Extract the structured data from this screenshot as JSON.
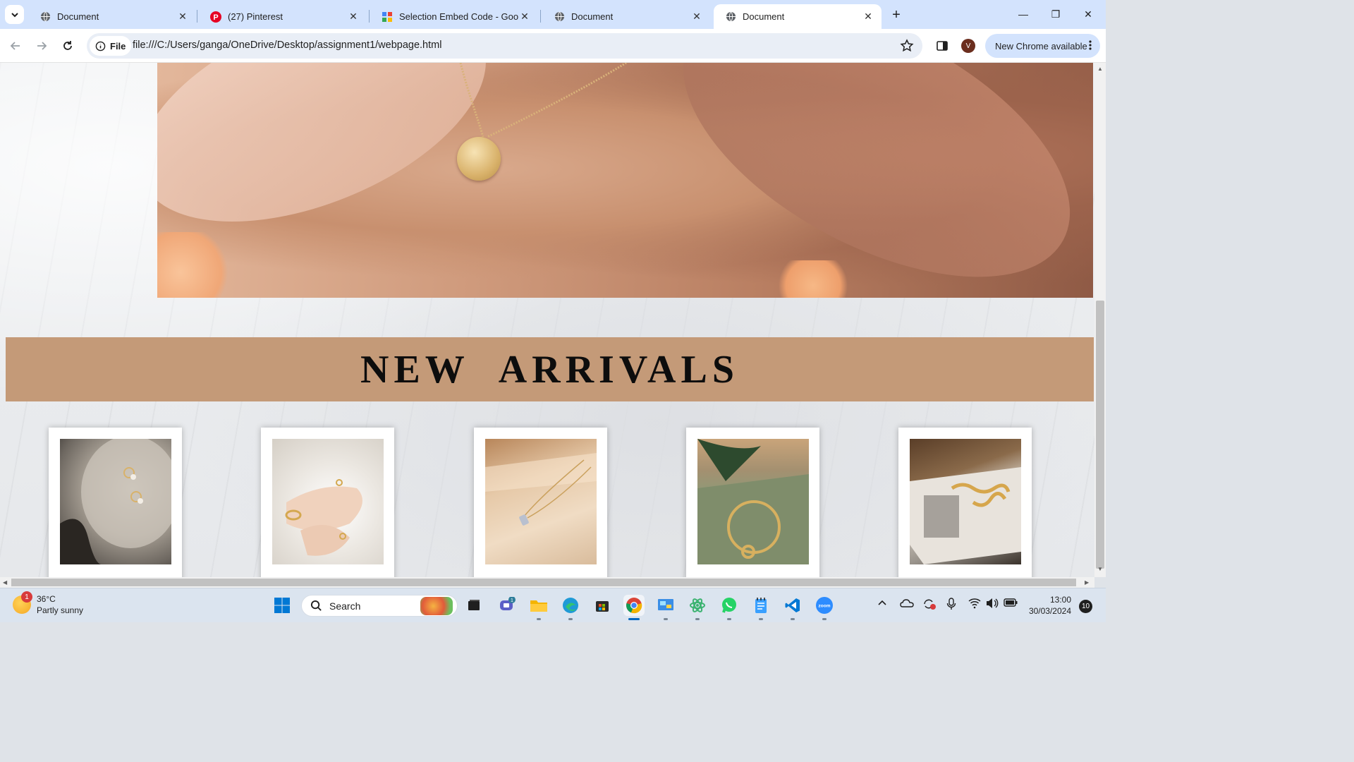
{
  "browser": {
    "tabs": [
      {
        "title": "Document",
        "favicon": "globe-icon",
        "active": false
      },
      {
        "title": "(27) Pinterest",
        "favicon": "pinterest-icon",
        "active": false
      },
      {
        "title": "Selection Embed Code - Google",
        "favicon": "google-sites-icon",
        "active": false
      },
      {
        "title": "Document",
        "favicon": "globe-icon",
        "active": false
      },
      {
        "title": "Document",
        "favicon": "globe-icon",
        "active": true
      }
    ],
    "site_chip": "File",
    "url": "file:///C:/Users/ganga/OneDrive/Desktop/assignment1/webpage.html",
    "avatar_letter": "V",
    "update_label": "New Chrome available"
  },
  "page": {
    "section_title": "NEW  ARRIVALS",
    "band_color": "#c49a78",
    "products": [
      {
        "image": "pearl-hoop-earrings-photo"
      },
      {
        "image": "gold-rings-bangle-photo"
      },
      {
        "image": "pendant-necklace-tray-photo"
      },
      {
        "image": "knot-bangle-photo"
      },
      {
        "image": "chain-bracelet-magazine-photo"
      }
    ]
  },
  "taskbar": {
    "weather_temp": "36°C",
    "weather_desc": "Partly sunny",
    "weather_badge": "1",
    "search_placeholder": "Search",
    "chat_badge": "1",
    "time": "13:00",
    "date": "30/03/2024",
    "notification_count": "10"
  }
}
